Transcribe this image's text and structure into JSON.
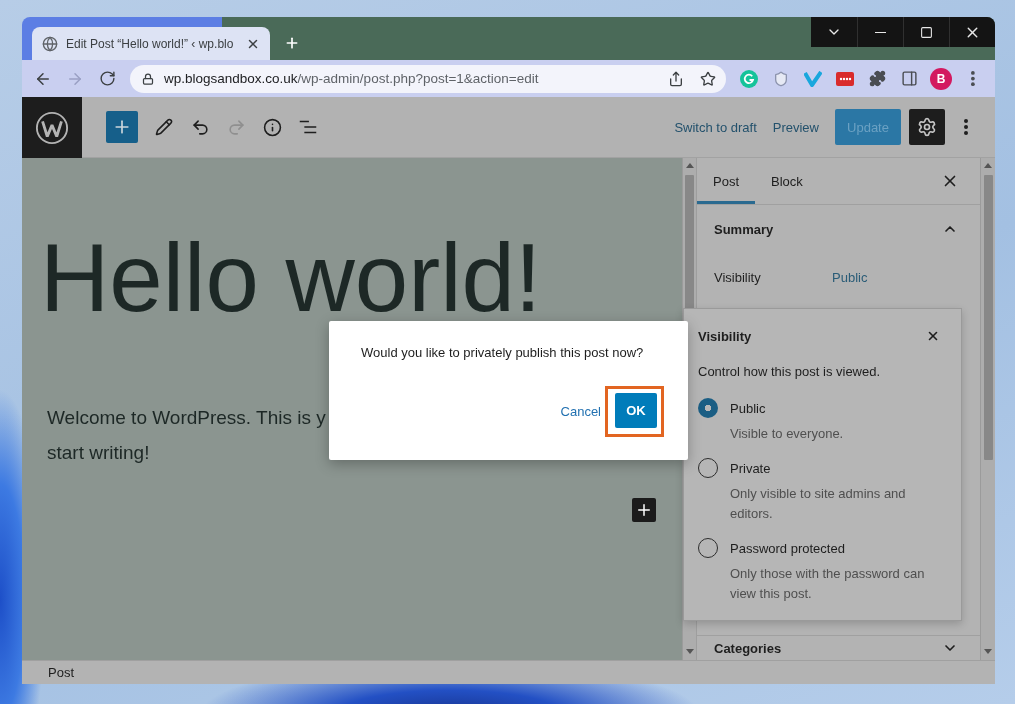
{
  "browser": {
    "tab_title": "Edit Post “Hello world!” ‹ wp.blo",
    "forward_disabled": true,
    "address": {
      "host": "wp.blogsandbox.co.uk",
      "path": "/wp-admin/post.php?post=1&action=edit"
    },
    "profile_initial": "B"
  },
  "editor": {
    "header": {
      "redo_disabled": true,
      "switch_to_draft": "Switch to draft",
      "preview": "Preview",
      "update": {
        "label": "Update",
        "disabled": true
      }
    },
    "title": "Hello world!",
    "paragraph_lines": [
      "Welcome to WordPress. This is y",
      "start writing!"
    ],
    "sidebar": {
      "tabs": [
        {
          "label": "Post",
          "selected": true
        },
        {
          "label": "Block",
          "selected": false
        }
      ],
      "panels": [
        {
          "title": "Summary",
          "expanded": true,
          "rows": [
            {
              "label": "Visibility",
              "value": "Public"
            }
          ]
        },
        {
          "title": "Categories",
          "expanded": false
        }
      ]
    },
    "visibility_popover": {
      "title": "Visibility",
      "intro": "Control how this post is viewed.",
      "options": [
        {
          "label": "Public",
          "description": "Visible to everyone.",
          "selected": true
        },
        {
          "label": "Private",
          "description": "Only visible to site admins and editors.",
          "selected": false
        },
        {
          "label": "Password protected",
          "description": "Only those with the password can view this post.",
          "selected": false
        }
      ]
    },
    "status_bar": {
      "breadcrumb": "Post"
    }
  },
  "dialog": {
    "message": "Would you like to privately publish this post now?",
    "buttons": [
      {
        "kind": "link",
        "label": "Cancel",
        "highlighted": false
      },
      {
        "kind": "primary",
        "label": "OK",
        "highlighted": true
      }
    ]
  }
}
